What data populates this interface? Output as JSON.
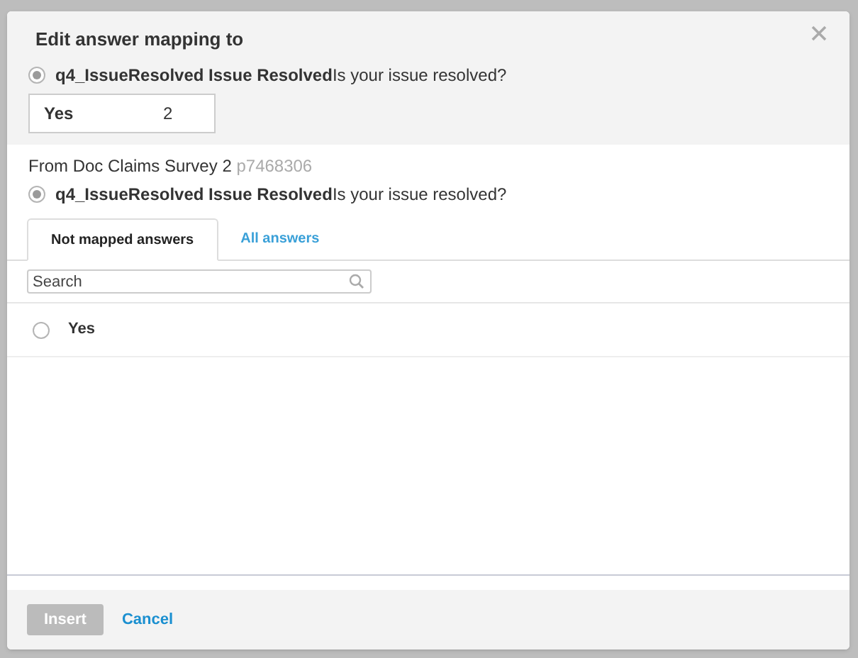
{
  "dialog": {
    "title": "Edit answer mapping to"
  },
  "target": {
    "question_code": "q4_IssueResolved Issue Resolved",
    "question_text": "Is your issue resolved?",
    "selected": true,
    "answer": "Yes",
    "count": "2"
  },
  "source": {
    "prefix": "From Doc Claims Survey 2",
    "id": "p7468306",
    "question_code": "q4_IssueResolved Issue Resolved",
    "question_text": "Is your issue resolved?",
    "selected": true
  },
  "tabs": [
    {
      "label": "Not mapped answers",
      "selected": true
    },
    {
      "label": "All answers",
      "selected": false
    }
  ],
  "search": {
    "placeholder": "Search"
  },
  "answers": [
    {
      "label": "Yes",
      "selected": false
    }
  ],
  "buttons": [
    {
      "label": "Insert",
      "kind": "primary",
      "disabled": true
    },
    {
      "label": "Cancel",
      "kind": "link",
      "disabled": false
    }
  ]
}
